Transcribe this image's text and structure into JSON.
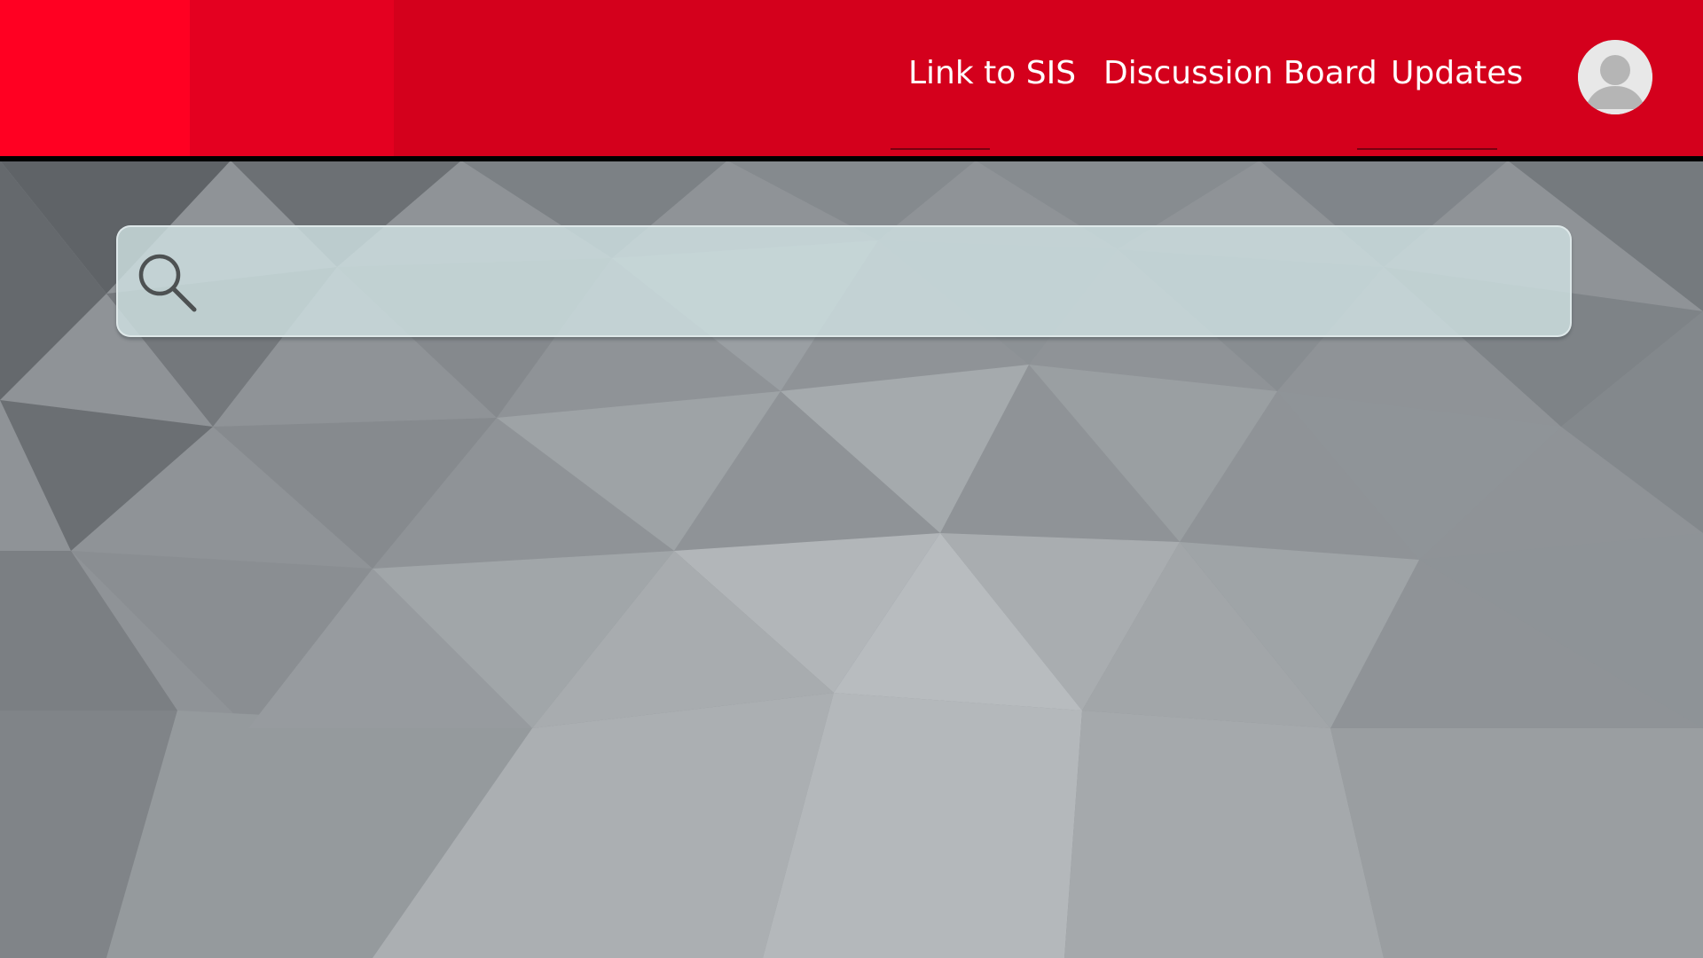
{
  "nav": {
    "links": [
      {
        "label": "Link to SIS"
      },
      {
        "label": "Discussion Board"
      },
      {
        "label": "Updates"
      }
    ]
  },
  "search": {
    "value": "",
    "placeholder": ""
  },
  "colors": {
    "header_red": "#d4001c",
    "header_block_bright": "#ff0022",
    "header_block_mid": "#e40020",
    "header_border": "#000000",
    "background_gray": "#8e9296",
    "search_fill": "#cee0e2"
  },
  "icons": {
    "search": "search-icon",
    "avatar": "user-avatar-icon"
  }
}
